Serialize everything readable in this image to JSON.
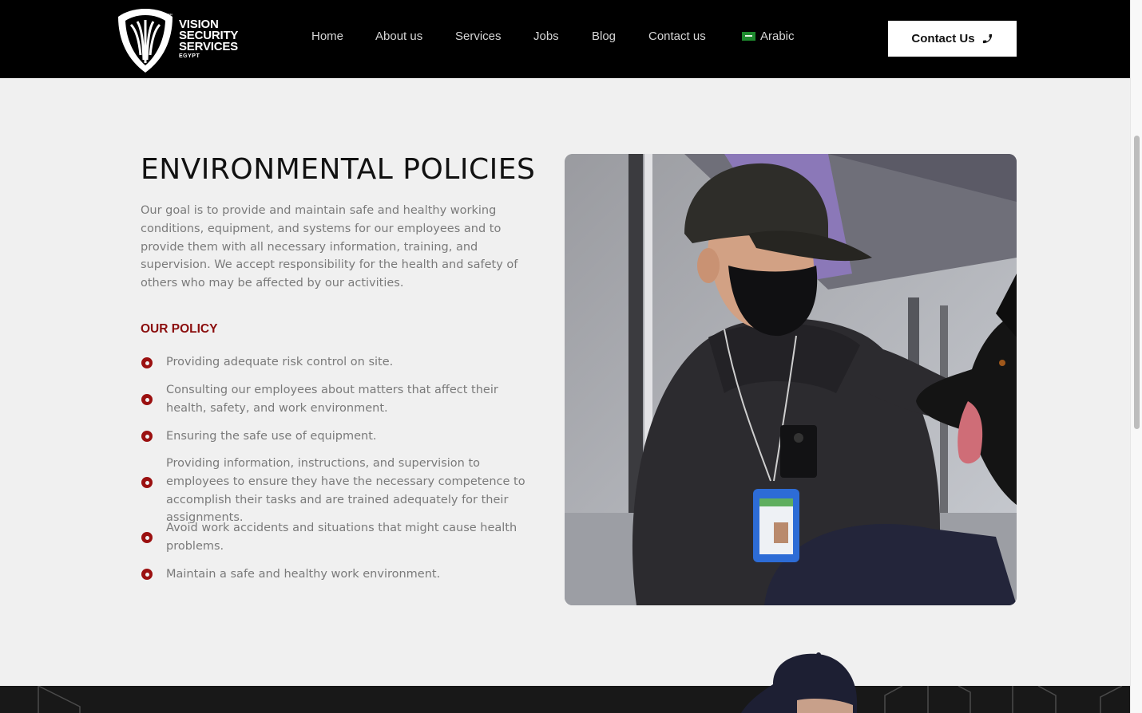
{
  "brand": {
    "name_line1": "VISION",
    "name_line2": "SECURITY",
    "name_line3": "SERVICES",
    "name_line4": "EGYPT"
  },
  "nav": {
    "items": [
      {
        "label": "Home"
      },
      {
        "label": "About us"
      },
      {
        "label": "Services"
      },
      {
        "label": "Jobs"
      },
      {
        "label": "Blog"
      },
      {
        "label": "Contact us"
      }
    ],
    "language": {
      "label": "Arabic",
      "icon": "saudi-flag-icon"
    },
    "contact_button": {
      "label": "Contact Us",
      "icon": "phone-icon"
    }
  },
  "content": {
    "title": "ENVIRONMENTAL POLICIES",
    "intro": "Our goal is to provide and maintain safe and healthy working conditions, equipment, and systems for our employees and to provide them with all necessary information, training, and supervision. We accept responsibility for the health and safety of others who may be affected by our activities.",
    "policy_heading": "OUR POLICY",
    "policies": [
      "Providing adequate risk control on site.",
      "Consulting our employees about matters that affect their health, safety, and work environment.",
      "Ensuring the safe use of equipment.",
      "Providing information, instructions, and supervision to employees to ensure they have the necessary competence to accomplish their tasks and are trained adequately for their assignments.",
      "Avoid work accidents and situations that might cause health problems.",
      "Maintain a safe and healthy work environment."
    ]
  },
  "colors": {
    "header_bg": "#000000",
    "accent": "#8b0d0d",
    "body_text": "#7a7a7a",
    "page_bg": "#f0f0f0"
  }
}
